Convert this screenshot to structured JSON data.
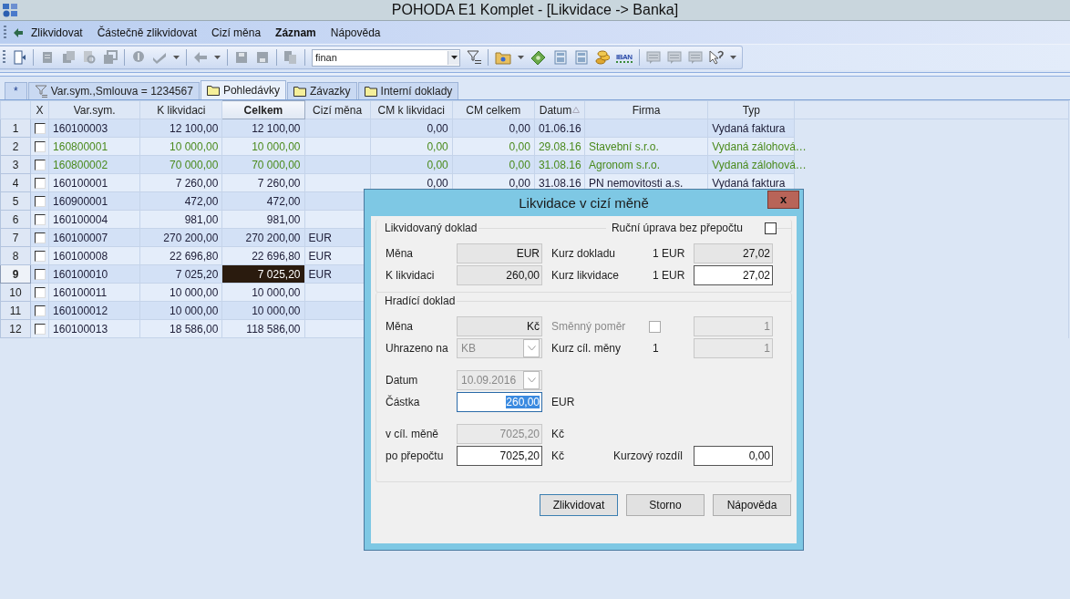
{
  "window": {
    "title": "POHODA E1 Komplet - [Likvidace -> Banka]"
  },
  "menu": [
    {
      "label": "Zlikvidovat",
      "bold": false
    },
    {
      "label": "Částečně zlikvidovat",
      "bold": false
    },
    {
      "label": "Cizí měna",
      "bold": false
    },
    {
      "label": "Záznam",
      "bold": true
    },
    {
      "label": "Nápověda",
      "bold": false
    }
  ],
  "toolbar": {
    "filter_value": "finan",
    "iban_label": "IBAN"
  },
  "tabs": [
    {
      "label": "*",
      "kind": "new",
      "selected": false
    },
    {
      "label": "Var.sym.,Smlouva = 1234567",
      "kind": "filter",
      "selected": false
    },
    {
      "label": "Pohledávky",
      "kind": "folder",
      "selected": true
    },
    {
      "label": "Závazky",
      "kind": "folder",
      "selected": false
    },
    {
      "label": "Interní doklady",
      "kind": "folder",
      "selected": false
    }
  ],
  "table": {
    "check_column": {
      "label": "X"
    },
    "columns": [
      {
        "label": "Var.sym.",
        "kind": "text",
        "active": false,
        "sorted": false
      },
      {
        "label": "K likvidaci",
        "kind": "number",
        "active": false,
        "sorted": false
      },
      {
        "label": "Celkem",
        "kind": "number",
        "active": true,
        "sorted": false
      },
      {
        "label": "Cizí měna",
        "kind": "text",
        "active": false,
        "sorted": false
      },
      {
        "label": "CM k likvidaci",
        "kind": "number",
        "active": false,
        "sorted": false
      },
      {
        "label": "CM celkem",
        "kind": "number",
        "active": false,
        "sorted": false
      },
      {
        "label": "Datum",
        "kind": "text",
        "active": false,
        "sorted": true
      },
      {
        "label": "Firma",
        "kind": "text",
        "active": false,
        "sorted": false
      },
      {
        "label": "Typ",
        "kind": "text",
        "active": false,
        "sorted": false
      }
    ],
    "rows": [
      {
        "number": "1",
        "checked": false,
        "selected": false,
        "color": "#20203a",
        "cells": [
          "160100003",
          "12 100,00",
          "12 100,00",
          null,
          "0,00",
          "0,00",
          "01.06.16",
          null,
          "Vydaná faktura"
        ]
      },
      {
        "number": "2",
        "checked": false,
        "selected": false,
        "color": "#4a8a1c",
        "cells": [
          "160800001",
          "10 000,00",
          "10 000,00",
          null,
          "0,00",
          "0,00",
          "29.08.16",
          "Stavební s.r.o.",
          "Vydaná zálohová…"
        ]
      },
      {
        "number": "3",
        "checked": false,
        "selected": false,
        "color": "#4a8a1c",
        "cells": [
          "160800002",
          "70 000,00",
          "70 000,00",
          null,
          "0,00",
          "0,00",
          "31.08.16",
          "Agronom s.r.o.",
          "Vydaná zálohová…"
        ]
      },
      {
        "number": "4",
        "checked": false,
        "selected": false,
        "color": "#20203a",
        "cells": [
          "160100001",
          "7 260,00",
          "7 260,00",
          null,
          "0,00",
          "0,00",
          "31.08.16",
          "PN nemovitosti a.s.",
          "Vydaná faktura"
        ]
      },
      {
        "number": "5",
        "checked": false,
        "selected": false,
        "color": "#20203a",
        "cells": [
          "160900001",
          "472,00",
          "472,00"
        ]
      },
      {
        "number": "6",
        "checked": false,
        "selected": false,
        "color": "#20203a",
        "cells": [
          "160100004",
          "981,00",
          "981,00"
        ]
      },
      {
        "number": "7",
        "checked": false,
        "selected": false,
        "color": "#20203a",
        "cells": [
          "160100007",
          "270 200,00",
          "270 200,00",
          "EUR"
        ]
      },
      {
        "number": "8",
        "checked": false,
        "selected": false,
        "color": "#20203a",
        "cells": [
          "160100008",
          "22 696,80",
          "22 696,80",
          "EUR"
        ]
      },
      {
        "number": "9",
        "checked": false,
        "selected": true,
        "color": "#20203a",
        "cells": [
          "160100010",
          "7 025,20",
          "7 025,20",
          "EUR"
        ]
      },
      {
        "number": "10",
        "checked": false,
        "selected": false,
        "color": "#20203a",
        "cells": [
          "160100011",
          "10 000,00",
          "10 000,00"
        ]
      },
      {
        "number": "11",
        "checked": false,
        "selected": false,
        "color": "#20203a",
        "cells": [
          "160100012",
          "10 000,00",
          "10 000,00"
        ]
      },
      {
        "number": "12",
        "checked": false,
        "selected": false,
        "color": "#20203a",
        "cells": [
          "160100013",
          "18 586,00",
          "118 586,00"
        ]
      }
    ]
  },
  "dialog": {
    "title": "Likvidace v cizí měně",
    "close_label": "x",
    "likvidovany": {
      "legend": "Likvidovaný doklad",
      "manual": {
        "label": "Ruční úprava bez přepočtu",
        "checked": false
      },
      "rows": [
        {
          "label": "Měna",
          "field": {
            "value": "EUR",
            "kind": "readonly",
            "focused": false
          },
          "label2": "Kurz dokladu",
          "label2_disabled": false,
          "unit": "1 EUR",
          "field2": {
            "value": "27,02",
            "kind": "readonly",
            "focused": false
          }
        },
        {
          "label": "K likvidaci",
          "field": {
            "value": "260,00",
            "kind": "readonly",
            "focused": false
          },
          "label2": "Kurz likvidace",
          "label2_disabled": false,
          "unit": "1 EUR",
          "field2": {
            "value": "27,02",
            "kind": "edit",
            "focused": false
          }
        }
      ]
    },
    "hradici": {
      "legend": "Hradící doklad",
      "rows": [
        {
          "label": "Měna",
          "field": {
            "value": "Kč",
            "kind": "readonly",
            "focused": false
          },
          "label2": "Směnný poměr",
          "label2_disabled": true,
          "check": {
            "checked": false
          },
          "field2": {
            "value": "1",
            "kind": "disabled",
            "focused": false
          }
        },
        {
          "label": "Uhrazeno na",
          "field": {
            "value": "KB",
            "kind": "combo",
            "focused": false
          },
          "label2": "Kurz cíl. měny",
          "label2_disabled": false,
          "unit": "1",
          "field2": {
            "value": "1",
            "kind": "disabled",
            "focused": false
          }
        },
        {
          "label": "Datum",
          "field": {
            "value": "10.09.2016",
            "kind": "combo",
            "focused": false
          }
        },
        {
          "label": "Částka",
          "field": {
            "value": "260,00",
            "kind": "edit",
            "focused": true
          },
          "label2": "EUR",
          "label2_disabled": false
        },
        {
          "label": "v cíl. měně",
          "field": {
            "value": "7025,20",
            "kind": "disabled",
            "focused": false
          },
          "label2": "Kč",
          "label2_disabled": false
        },
        {
          "label": "po přepočtu",
          "field": {
            "value": "7025,20",
            "kind": "edit",
            "focused": false
          },
          "label2": "Kč",
          "label2_disabled": false,
          "label3": "Kurzový rozdíl",
          "field2": {
            "value": "0,00",
            "kind": "edit",
            "focused": false
          }
        }
      ]
    },
    "buttons": [
      {
        "label": "Zlikvidovat",
        "default": true
      },
      {
        "label": "Storno",
        "default": false
      },
      {
        "label": "Nápověda",
        "default": false
      }
    ]
  }
}
